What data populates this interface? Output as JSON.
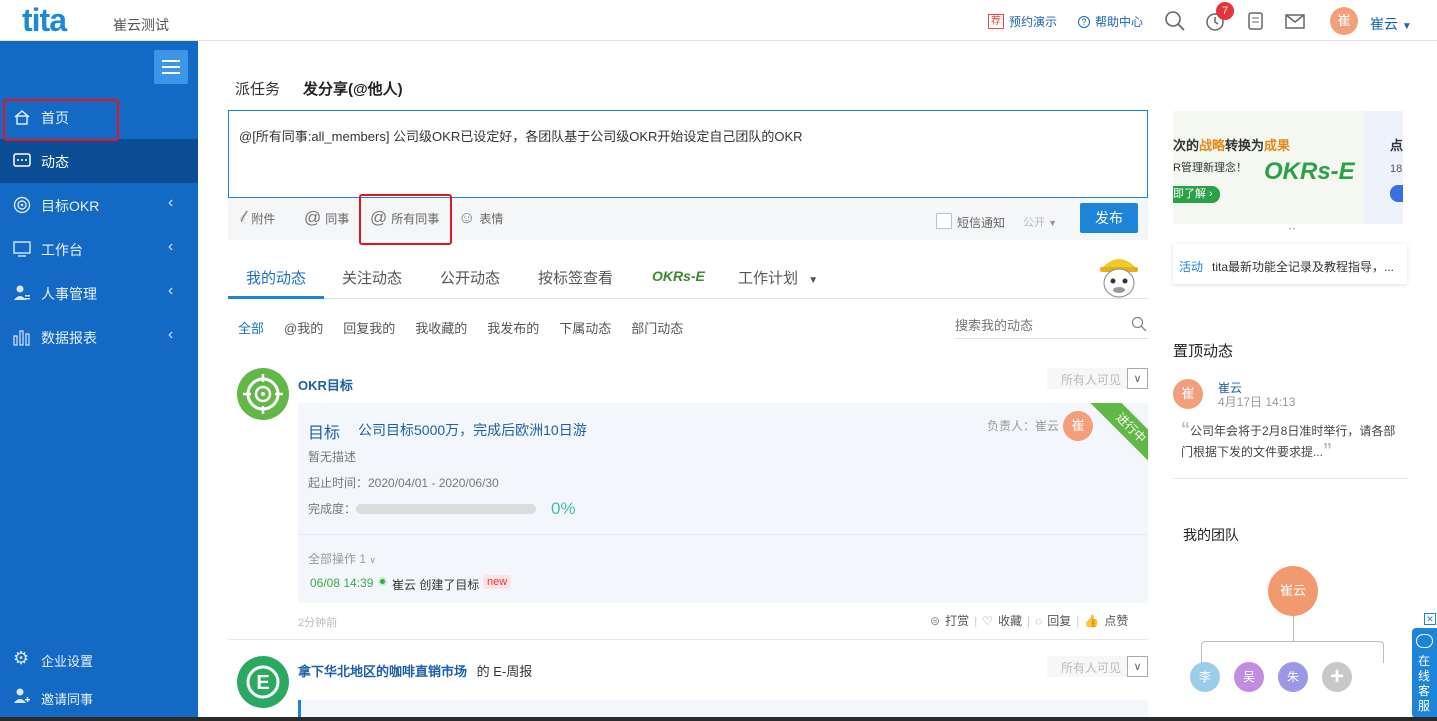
{
  "header": {
    "logo": "tita",
    "company": "崔云测试",
    "demo_badge": "荐",
    "demo": "预约演示",
    "help_icon": "?",
    "help": "帮助中心",
    "notify_count": "7",
    "avatar": "崔",
    "user": "崔云"
  },
  "sidebar": {
    "items": [
      {
        "label": "首页"
      },
      {
        "label": "动态"
      },
      {
        "label": "目标OKR",
        "chev": "‹"
      },
      {
        "label": "工作台",
        "chev": "‹"
      },
      {
        "label": "人事管理",
        "chev": "‹"
      },
      {
        "label": "数据报表",
        "chev": "‹"
      }
    ],
    "bottom": [
      {
        "label": "企业设置"
      },
      {
        "label": "邀请同事"
      }
    ]
  },
  "composer": {
    "tabs": [
      "派任务",
      "发分享(@他人)"
    ],
    "text": "@[所有同事:all_members] 公司级OKR已设定好，各团队基于公司级OKR开始设定自己团队的OKR",
    "tools": [
      "附件",
      "同事",
      "所有同事",
      "表情"
    ],
    "sms": "短信通知",
    "visibility": "公开",
    "publish": "发布"
  },
  "feed_tabs": [
    "我的动态",
    "关注动态",
    "公开动态",
    "按标签查看",
    "工作计划"
  ],
  "okrs_logo": "OKRs-E",
  "filters": [
    "全部",
    "@我的",
    "回复我的",
    "我收藏的",
    "我发布的",
    "下属动态",
    "部门动态"
  ],
  "search_placeholder": "搜索我的动态",
  "post1": {
    "source": "OKR目标",
    "visibility": "所有人可见",
    "label": "目标",
    "title": "公司目标5000万，完成后欧洲10日游",
    "owner_label": "负责人：崔云",
    "owner_avatar": "崔",
    "ribbon": "进行中",
    "desc": "暂无描述",
    "period": "起止时间：2020/04/01 - 2020/06/30",
    "progress_label": "完成度：",
    "progress": "0%",
    "progress_value": 0,
    "ops_title": "全部操作  1",
    "op_time": "06/08 14:39",
    "op_text": "崔云 创建了目标",
    "op_badge": "new",
    "time_ago": "2分钟前",
    "actions": [
      "打赏",
      "收藏",
      "回复",
      "点赞"
    ]
  },
  "post2": {
    "source": "拿下华北地区的咖啡直销市场",
    "suffix": "的 E-周报",
    "visibility": "所有人可见"
  },
  "right": {
    "banner_title_pre": "次的",
    "banner_title_hl1": "战略",
    "banner_title_mid": "转换为",
    "banner_title_hl2": "成果",
    "banner_sub": "R管理新理念！",
    "banner_btn": "即了解 ›",
    "banner_logo": "OKRs-E",
    "banner2_title": "点",
    "banner2_sub": "18",
    "activity_tag": "活动",
    "activity_text": "tita最新功能全记录及教程指导，...",
    "pinned_title": "置顶动态",
    "pinned_user": "崔云",
    "pinned_avatar": "崔",
    "pinned_time": "4月17日 14:13",
    "pinned_text": "公司年会将于2月8日准时举行，请各部门根据下发的文件要求提...",
    "team_title": "我的团队",
    "team_root": "崔云",
    "team_members": [
      "李",
      "吴",
      "朱"
    ],
    "online_service": "在线客服"
  },
  "colors": {
    "brand": "#1469c4",
    "accent": "#1e84d8",
    "red": "#e8131e",
    "green": "#62b846",
    "teal": "#3ec0a8"
  }
}
